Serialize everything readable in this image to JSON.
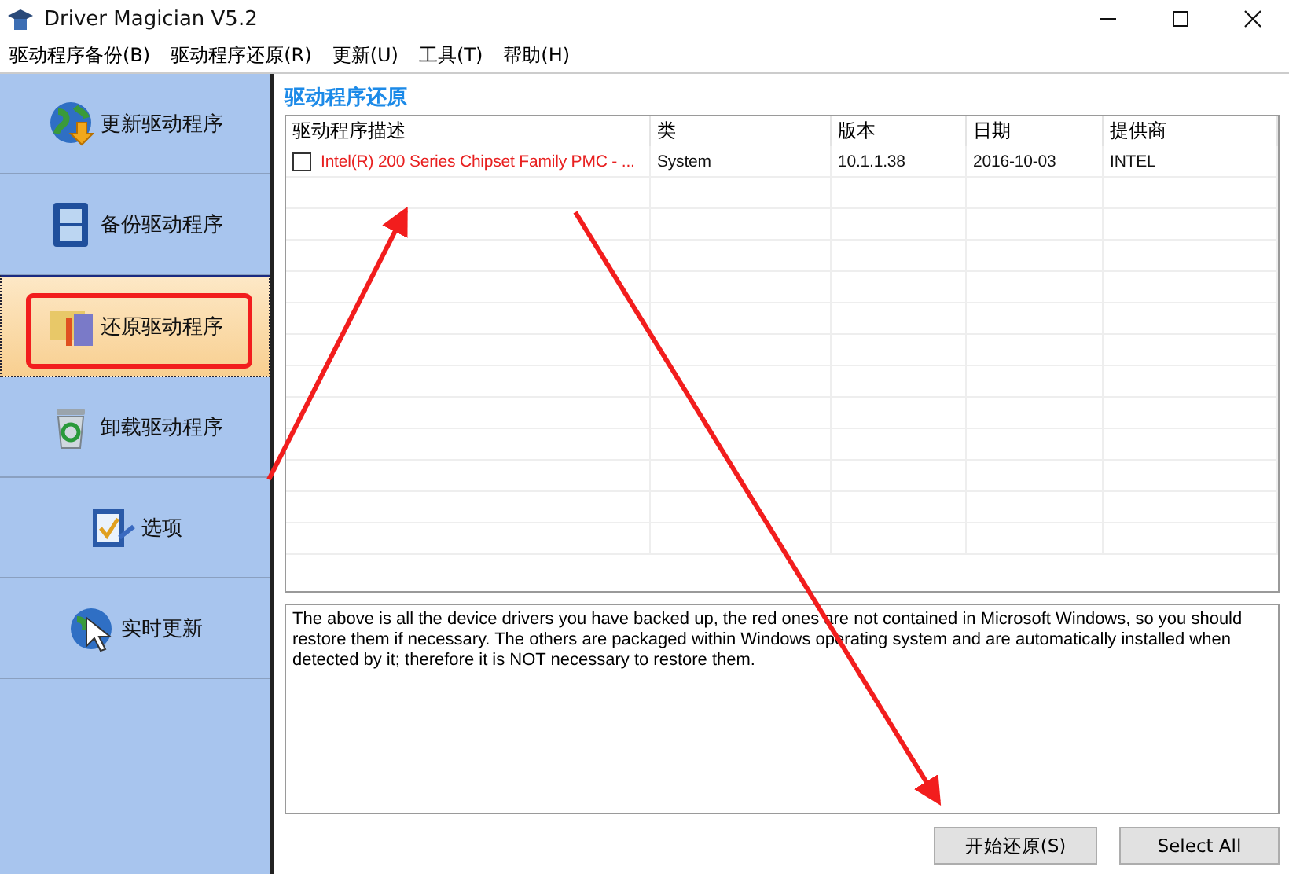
{
  "window": {
    "title": "Driver Magician V5.2"
  },
  "menu": [
    "驱动程序备份(B)",
    "驱动程序还原(R)",
    "更新(U)",
    "工具(T)",
    "帮助(H)"
  ],
  "sidebar": {
    "items": [
      {
        "label": "更新驱动程序",
        "selected": false
      },
      {
        "label": "备份驱动程序",
        "selected": false
      },
      {
        "label": "还原驱动程序",
        "selected": true
      },
      {
        "label": "卸载驱动程序",
        "selected": false
      },
      {
        "label": "选项",
        "selected": false
      },
      {
        "label": "实时更新",
        "selected": false
      }
    ]
  },
  "panel": {
    "heading": "驱动程序还原",
    "table": {
      "columns": [
        "驱动程序描述",
        "类",
        "版本",
        "日期",
        "提供商"
      ],
      "rows": [
        {
          "checked": false,
          "not_in_windows": true,
          "cells": [
            "Intel(R) 200 Series Chipset Family PMC - ...",
            "System",
            "10.1.1.38",
            "2016-10-03",
            "INTEL"
          ]
        }
      ]
    },
    "note": "The above is all the device drivers you have backed up, the red ones are not contained in Microsoft Windows, so you should restore them if necessary. The others are packaged within Windows operating system and are automatically installed when detected by it; therefore it is NOT necessary to restore them.",
    "buttons": [
      "开始还原(S)",
      "Select All"
    ]
  }
}
